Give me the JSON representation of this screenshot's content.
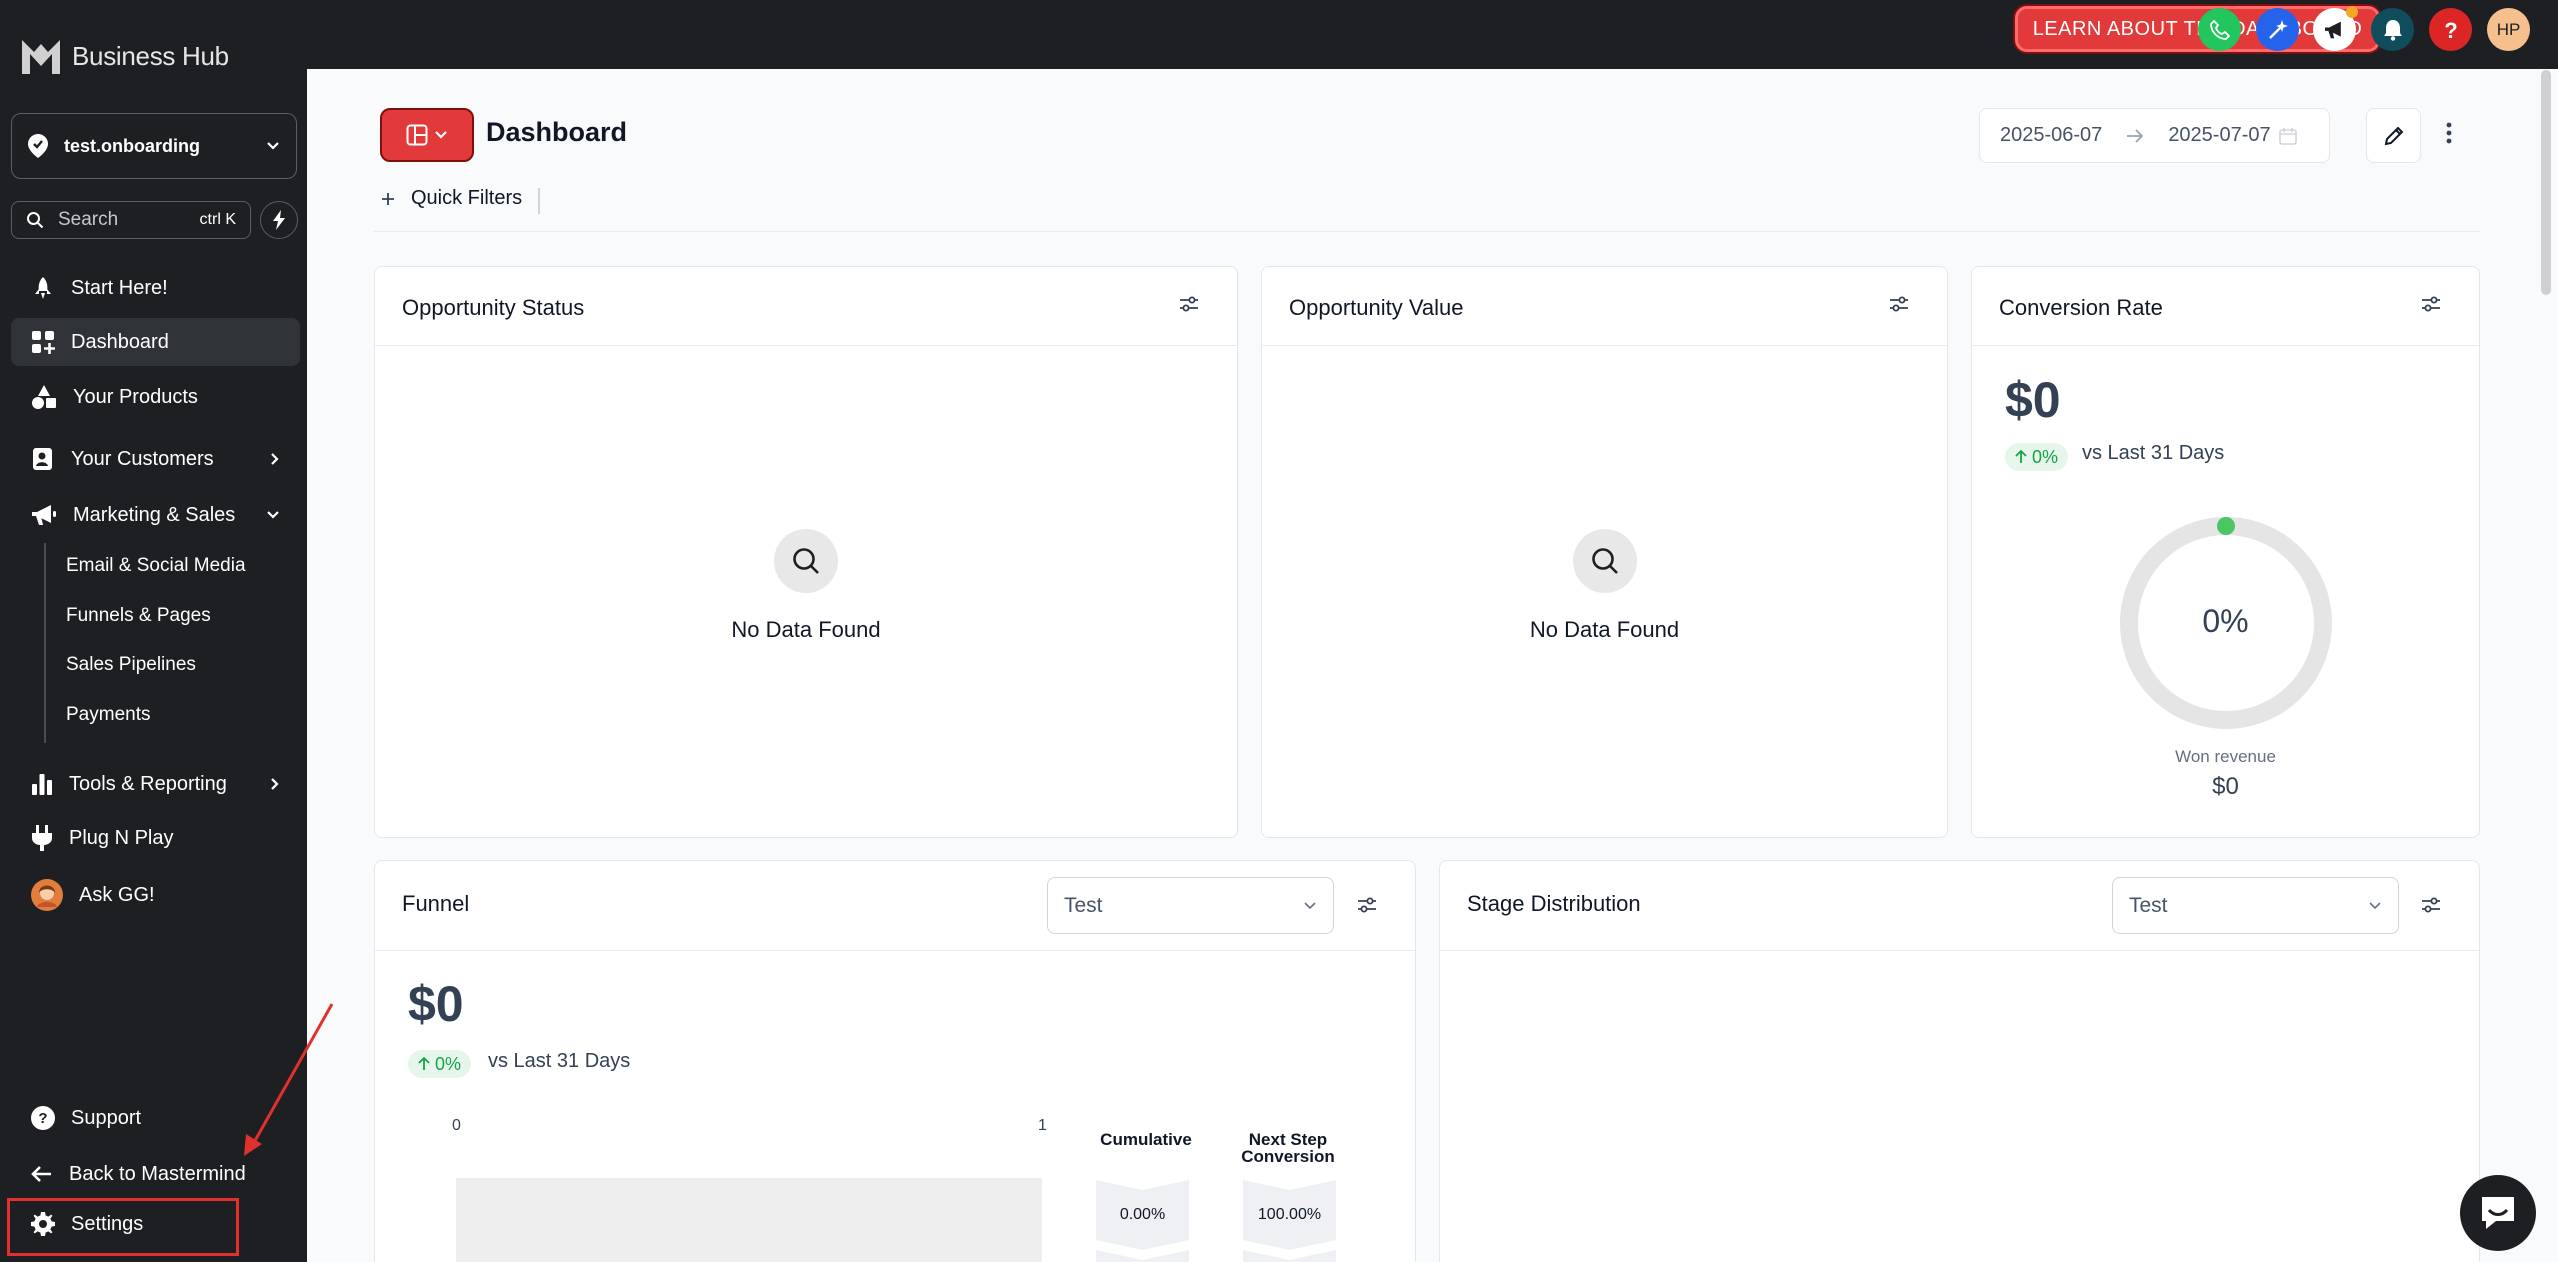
{
  "brand": {
    "name": "Business Hub"
  },
  "account": {
    "name": "test.onboarding"
  },
  "search": {
    "label": "Search",
    "shortcut": "ctrl K"
  },
  "nav": {
    "start": "Start Here!",
    "dashboard": "Dashboard",
    "products": "Your Products",
    "customers": "Your Customers",
    "marketing": "Marketing & Sales",
    "marketing_sub": [
      "Email & Social Media",
      "Funnels & Pages",
      "Sales Pipelines",
      "Payments"
    ],
    "tools": "Tools & Reporting",
    "plug": "Plug N Play",
    "askgg": "Ask GG!"
  },
  "bottom_nav": {
    "support": "Support",
    "back": "Back to Mastermind",
    "settings": "Settings"
  },
  "topbar": {
    "learn_label": "LEARN ABOUT THE DASHBOARD",
    "avatar_initials": "HP"
  },
  "header": {
    "title": "Dashboard",
    "date_start": "2025-06-07",
    "date_end": "2025-07-07",
    "quick_filters": "Quick Filters"
  },
  "cards": {
    "opportunity_status": {
      "title": "Opportunity Status",
      "empty": "No Data Found"
    },
    "opportunity_value": {
      "title": "Opportunity Value",
      "empty": "No Data Found"
    },
    "conversion_rate": {
      "title": "Conversion Rate",
      "value": "$0",
      "change": "0%",
      "vs": "vs Last 31 Days",
      "donut_pct": "0%",
      "won_label": "Won revenue",
      "won_value": "$0"
    },
    "funnel": {
      "title": "Funnel",
      "select": "Test",
      "value": "$0",
      "change": "0%",
      "vs": "vs Last 31 Days",
      "axis_min": "0",
      "axis_max": "1",
      "cumulative_label": "Cumulative",
      "next_step_label_1": "Next Step",
      "next_step_label_2": "Conversion",
      "cumulative_value": "0.00%",
      "next_step_value": "100.00%"
    },
    "stage_distribution": {
      "title": "Stage Distribution",
      "select": "Test"
    }
  },
  "colors": {
    "sidebar_bg": "#1d1f22",
    "accent_red": "#e23a3a",
    "success_green": "#16a34a",
    "phone_green": "#22c55e",
    "ai_blue": "#2563eb",
    "bell_teal": "#0f4c5c",
    "help_red": "#dc2626",
    "avatar_peach": "#f6c08e"
  }
}
